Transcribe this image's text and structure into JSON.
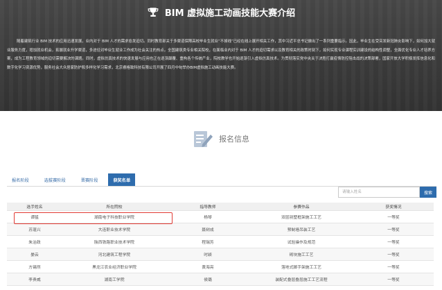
{
  "hero": {
    "title": "BIM 虚拟施工动画技能大赛介绍",
    "description": "随着建筑行业 BIM 技术的应用迅速发展，业内对于 BIM 人才的需求愈发迫切。同时教育部关于多渠道保障高校毕业生就业“不掉线”已经在线上展开相关工作，其中习近平总书记做出了一系列重要指示。因此，毕业生在受突发新冠肺炎影响下，如何加大就业服务力度，增加就业机会，拓展就业升学渠道，多途径对毕业生就业工作成为社会关注的热点。全国建筑类专业相关院校，在面临业内对于 BIM 人才的迫切需求以及教育相关的政策时刻下，如何实现专业课程实训建设的结构性调整，全面优化专业人才培养方案，成为工程教育领域的迫切需要解决的课题。同时，虚拟仿真技术的快速发展与应用也正在逐渐颠覆、重构各个传统产业，院校教学也开始逐渐引入虚拟仿真技术。为贯彻落实党中央关于决胜打赢疫情防控阻击战的决策部署，国家开放大学积极发挥信息化和数字化学习资源优势，服务社会大众居家防护和多样化学习需求，北京睿格致科技有限公司开展了四月中旬举办BIM虚拟施工动画技能大赛。"
  },
  "signup": {
    "label": "报名信息"
  },
  "tabs": [
    {
      "label": "报名阶段",
      "active": false
    },
    {
      "label": "选拔赛阶段",
      "active": false
    },
    {
      "label": "晋赛阶段",
      "active": false
    },
    {
      "label": "获奖名单",
      "active": true
    }
  ],
  "search": {
    "placeholder": "请输入姓名",
    "button_label": "搜索"
  },
  "table": {
    "headers": [
      "选手姓名",
      "所在院校",
      "指导教师",
      "参赛作品",
      "获奖情况"
    ],
    "rows": [
      [
        "谭猛",
        "湖南电子科技职业学院",
        "杨琴",
        "双层别墅框架施工工艺",
        "一等奖"
      ],
      [
        "苏蓬兴",
        "大连职业技术学院",
        "聂树成",
        "预制墙吊装工艺",
        "一等奖"
      ],
      [
        "朱治政",
        "陕西铁路职业技术学院",
        "程瑞芳",
        "试验操作及规范",
        "一等奖"
      ],
      [
        "晏云",
        "河北建筑工程学院",
        "时颖",
        "砌块施工工艺",
        "一等奖"
      ],
      [
        "方锡然",
        "黑龙江农业经济职业学院",
        "黄海亮",
        "落地式脚手架施工工艺",
        "一等奖"
      ],
      [
        "李贵威",
        "湖南工学院",
        "侯璐",
        "装配式叠层叠层施工工艺流程",
        "一等奖"
      ]
    ]
  },
  "colors": {
    "accent": "#2e6cad",
    "highlight": "#e13a33",
    "hero_bg": "#3d3d3d"
  }
}
